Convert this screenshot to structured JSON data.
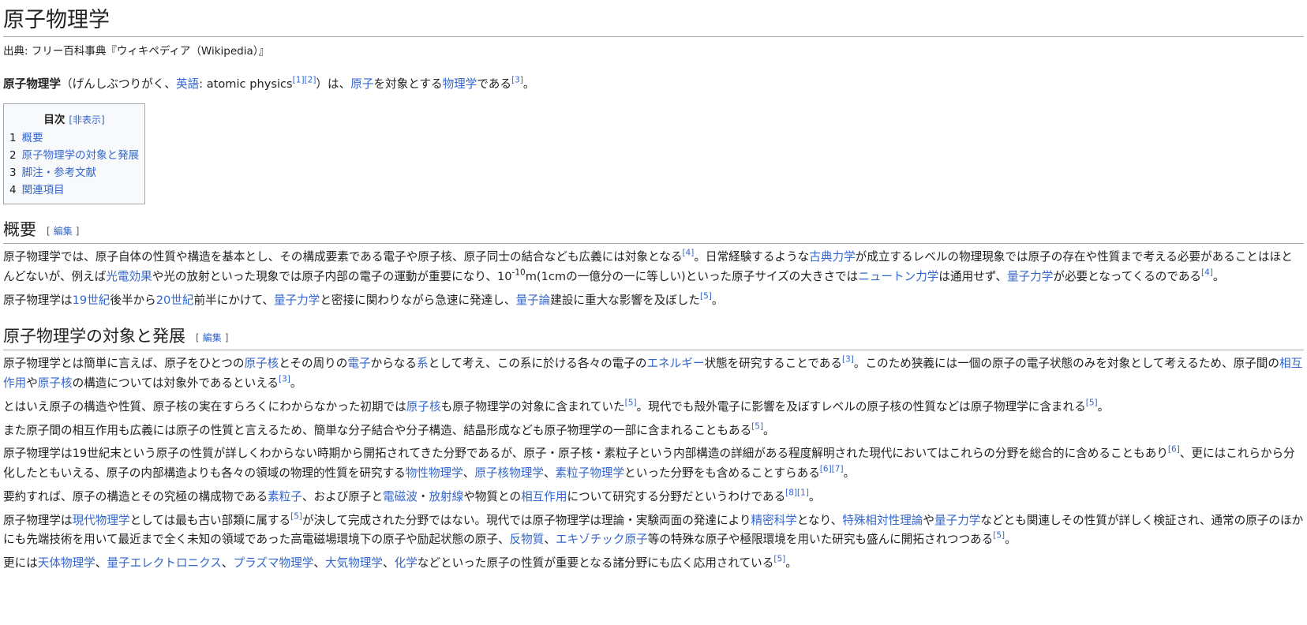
{
  "title": "原子物理学",
  "site_sub": "出典: フリー百科事典『ウィキペディア（Wikipedia）』",
  "lead": {
    "bold": "原子物理学",
    "t1": "（げんしぶつりがく、",
    "link_eigo": "英語",
    "t2": ": atomic physics",
    "ref1": "[1]",
    "ref2": "[2]",
    "t3": "）は、",
    "link_genshi": "原子",
    "t4": "を対象とする",
    "link_butsurigaku": "物理学",
    "t5": "である",
    "ref3": "[3]",
    "t6": "。"
  },
  "toc": {
    "title": "目次",
    "toggle": "[非表示]",
    "items": [
      {
        "num": "1",
        "label": "概要"
      },
      {
        "num": "2",
        "label": "原子物理学の対象と発展"
      },
      {
        "num": "3",
        "label": "脚注・参考文献"
      },
      {
        "num": "4",
        "label": "関連項目"
      }
    ]
  },
  "edit_open": "[",
  "edit_label": "編集",
  "edit_close": "]",
  "section1": {
    "heading": "概要",
    "p1": {
      "t1": "原子物理学では、原子自体の性質や構造を基本とし、その構成要素である電子や原子核、原子同士の結合なども広義には対象となる",
      "ref1": "[4]",
      "t2": "。日常経験するような",
      "l1": "古典力学",
      "t3": "が成立するレベルの物理現象では原子の存在や性質まで考える必要があることはほとんどないが、例えば",
      "l2": "光電効果",
      "t4": "や光の放射といった現象では原子内部の電子の運動が重要になり、10",
      "sup": "-10",
      "t5": "m(1cmの一億分の一に等しい)といった原子サイズの大きさでは",
      "l3": "ニュートン力学",
      "t6": "は通用せず、",
      "l4": "量子力学",
      "t7": "が必要となってくるのである",
      "ref2": "[4]",
      "t8": "。"
    },
    "p2": {
      "t1": "原子物理学は",
      "l1": "19世紀",
      "t2": "後半から",
      "l2": "20世紀",
      "t3": "前半にかけて、",
      "l3": "量子力学",
      "t4": "と密接に関わりながら急速に発達し、",
      "l4": "量子論",
      "t5": "建設に重大な影響を及ぼした",
      "ref1": "[5]",
      "t6": "。"
    }
  },
  "section2": {
    "heading": "原子物理学の対象と発展",
    "p1": {
      "t1": "原子物理学とは簡単に言えば、原子をひとつの",
      "l1": "原子核",
      "t2": "とその周りの",
      "l2": "電子",
      "t3": "からなる",
      "l3": "系",
      "t4": "として考え、この系に於ける各々の電子の",
      "l4": "エネルギー",
      "t5": "状態を研究することである",
      "ref1": "[3]",
      "t6": "。このため狭義には一個の原子の電子状態のみを対象として考えるため、原子間の",
      "l5": "相互作用",
      "t7": "や",
      "l6": "原子核",
      "t8": "の構造については対象外であるといえる",
      "ref2": "[3]",
      "t9": "。"
    },
    "p2": {
      "t1": "とはいえ原子の構造や性質、原子核の実在すらろくにわからなかった初期では",
      "l1": "原子核",
      "t2": "も原子物理学の対象に含まれていた",
      "ref1": "[5]",
      "t3": "。現代でも殻外電子に影響を及ぼすレベルの原子核の性質などは原子物理学に含まれる",
      "ref2": "[5]",
      "t4": "。"
    },
    "p3": {
      "t1": "また原子間の相互作用も広義には原子の性質と言えるため、簡単な分子結合や分子構造、結晶形成なども原子物理学の一部に含まれることもある",
      "ref1": "[5]",
      "t2": "。"
    },
    "p4": {
      "t1": "原子物理学は19世紀末という原子の性質が詳しくわからない時期から開拓されてきた分野であるが、原子・原子核・素粒子という内部構造の詳細がある程度解明された現代においてはこれらの分野を総合的に含めることもあり",
      "ref1": "[6]",
      "t2": "、更にはこれらから分化したともいえる、原子の内部構造よりも各々の領域の物理的性質を研究する",
      "l1": "物性物理学",
      "t3": "、",
      "l2": "原子核物理学",
      "t4": "、",
      "l3": "素粒子物理学",
      "t5": "といった分野をも含めることすらある",
      "ref2": "[6]",
      "ref3": "[7]",
      "t6": "。"
    },
    "p5": {
      "t1": "要約すれば、原子の構造とその究極の構成物である",
      "l1": "素粒子",
      "t2": "、および原子と",
      "l2": "電磁波",
      "t3": "・",
      "l3": "放射線",
      "t4": "や物質との",
      "l4": "相互作用",
      "t5": "について研究する分野だというわけである",
      "ref1": "[8]",
      "ref2": "[1]",
      "t6": "。"
    },
    "p6": {
      "t1": "原子物理学は",
      "l1": "現代物理学",
      "t2": "としては最も古い部類に属する",
      "ref1": "[5]",
      "t3": "が決して完成された分野ではない。現代では原子物理学は理論・実験両面の発達により",
      "l2": "精密科学",
      "t4": "となり、",
      "l3": "特殊相対性理論",
      "t5": "や",
      "l4": "量子力学",
      "t6": "などとも関連しその性質が詳しく検証され、通常の原子のほかにも先端技術を用いて最近まで全く未知の領域であった高電磁場環境下の原子や励起状態の原子、",
      "l5": "反物質",
      "t7": "、",
      "l6": "エキゾチック原子",
      "t8": "等の特殊な原子や極限環境を用いた研究も盛んに開拓されつつある",
      "ref2": "[5]",
      "t9": "。"
    },
    "p7": {
      "t1": "更には",
      "l1": "天体物理学",
      "t2": "、",
      "l2": "量子エレクトロニクス",
      "t3": "、",
      "l3": "プラズマ物理学",
      "t4": "、",
      "l4": "大気物理学",
      "t5": "、",
      "l5": "化学",
      "t6": "などといった原子の性質が重要となる諸分野にも広く応用されている",
      "ref1": "[5]",
      "t7": "。"
    }
  },
  "colors": {
    "link": "#3366cc",
    "text": "#202122",
    "border": "#a2a9b1",
    "toc_bg": "#f8f9fa"
  }
}
